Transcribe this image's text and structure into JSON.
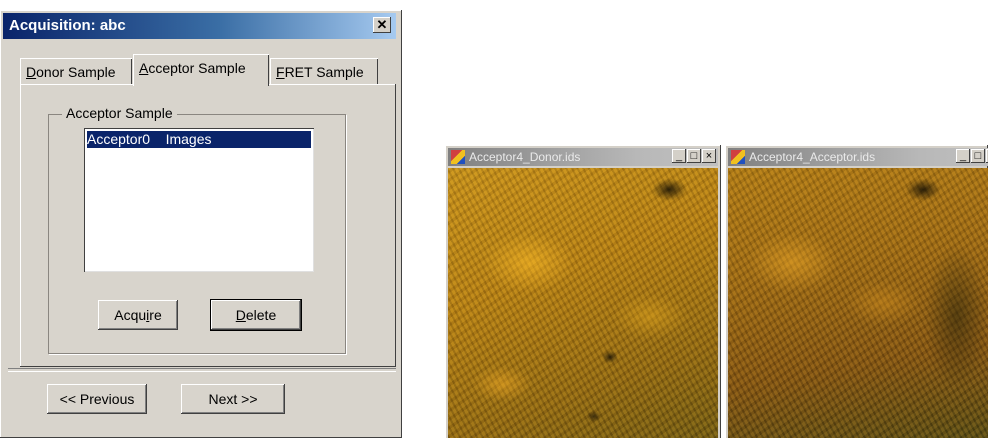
{
  "dialog": {
    "title": "Acquisition: abc",
    "close_glyph": "✕",
    "tabs": [
      {
        "mnemonic": "D",
        "rest": "onor Sample",
        "active": false
      },
      {
        "mnemonic": "A",
        "rest": "cceptor Sample",
        "active": true
      },
      {
        "mnemonic": "F",
        "rest": "RET Sample",
        "active": false
      }
    ],
    "group": {
      "legend": "Acceptor Sample",
      "list_items": [
        "Acceptor0    Images"
      ],
      "selected_index": 0
    },
    "acquire_button": {
      "pre": "Acqu",
      "mnemonic": "i",
      "post": "re"
    },
    "delete_button": {
      "pre": "",
      "mnemonic": "D",
      "post": "elete"
    },
    "previous_button": "<< Previous",
    "next_button": "Next >>"
  },
  "windows": [
    {
      "title": "Acceptor4_Donor.ids",
      "icon": "image-window-icon"
    },
    {
      "title": "Acceptor4_Acceptor.ids",
      "icon": "image-window-icon"
    }
  ],
  "window_buttons": {
    "minimize": "_",
    "maximize": "□",
    "close": "×"
  },
  "colors": {
    "title_active": "#0a246a",
    "title_inactive": "#808080",
    "selection": "#0a246a",
    "face": "#d4d0c8"
  }
}
